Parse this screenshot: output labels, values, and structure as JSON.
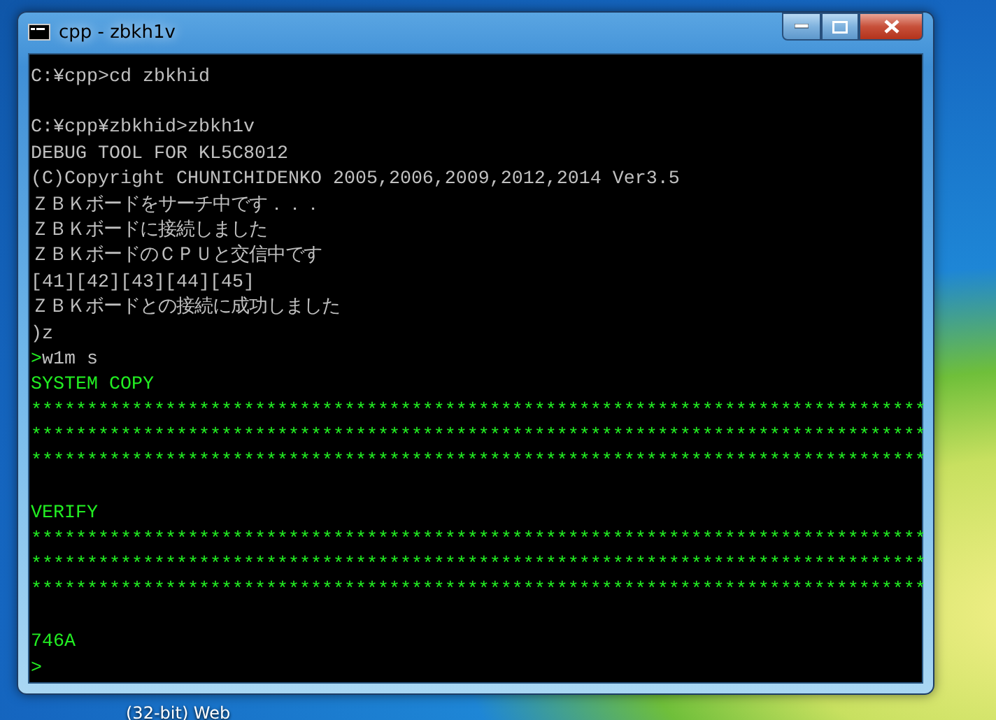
{
  "desktop": {
    "bottom_labels": [
      "(32-bit) Web"
    ]
  },
  "window": {
    "title": "cpp - zbkh1v"
  },
  "console": {
    "lines": [
      {
        "kind": "output",
        "text": "C:¥cpp>cd zbkhid"
      },
      {
        "kind": "blank"
      },
      {
        "kind": "output",
        "text": "C:¥cpp¥zbkhid>zbkh1v"
      },
      {
        "kind": "output",
        "text": "DEBUG TOOL FOR KL5C8012"
      },
      {
        "kind": "output",
        "text": "(C)Copyright CHUNICHIDENKO 2005,2006,2009,2012,2014 Ver3.5"
      },
      {
        "kind": "output",
        "text": "ＺＢＫボードをサーチ中です．．．"
      },
      {
        "kind": "output",
        "text": "ＺＢＫボードに接続しました"
      },
      {
        "kind": "output",
        "text": "ＺＢＫボードのＣＰＵと交信中です"
      },
      {
        "kind": "output",
        "text": "[41][42][43][44][45]"
      },
      {
        "kind": "output",
        "text": "ＺＢＫボードとの接続に成功しました"
      },
      {
        "kind": "output",
        "text": ")z"
      },
      {
        "kind": "prompt",
        "prompt": ">",
        "text": "w1m s"
      },
      {
        "kind": "status",
        "text": "SYSTEM COPY"
      },
      {
        "kind": "status",
        "text": "********************************************************************************"
      },
      {
        "kind": "status",
        "text": "********************************************************************************"
      },
      {
        "kind": "status",
        "text": "********************************************************************************"
      },
      {
        "kind": "blank"
      },
      {
        "kind": "status",
        "text": "VERIFY"
      },
      {
        "kind": "status",
        "text": "********************************************************************************"
      },
      {
        "kind": "status",
        "text": "********************************************************************************"
      },
      {
        "kind": "status",
        "text": "********************************************************************************"
      },
      {
        "kind": "blank"
      },
      {
        "kind": "status",
        "text": "746A"
      },
      {
        "kind": "prompt",
        "prompt": ">"
      }
    ]
  }
}
